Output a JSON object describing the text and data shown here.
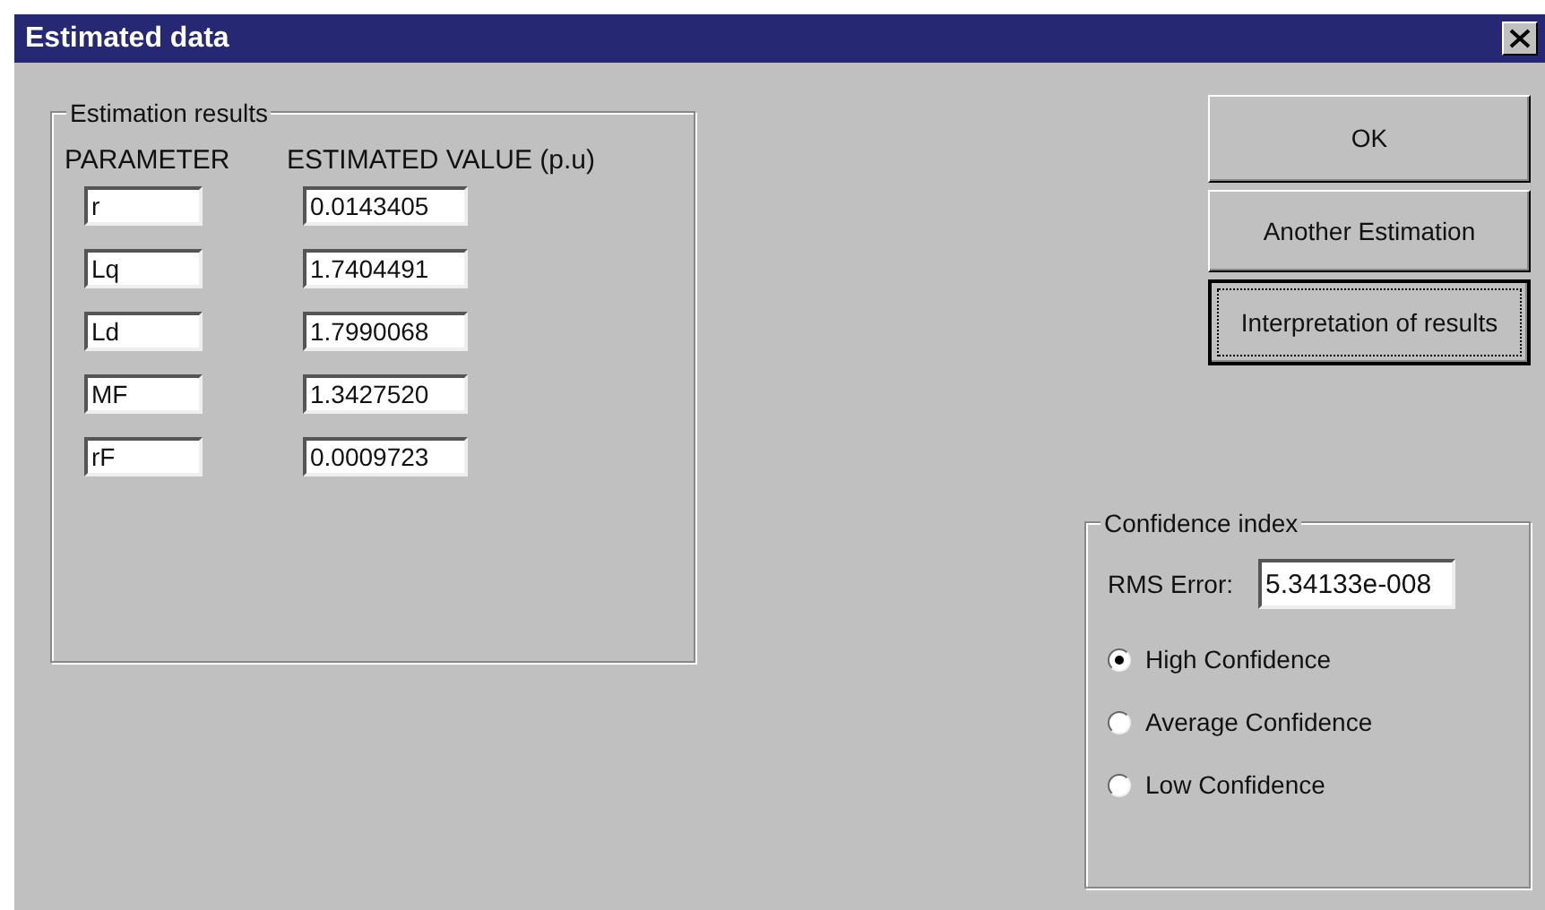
{
  "window": {
    "title": "Estimated data"
  },
  "estimation_results": {
    "title": "Estimation results",
    "column_headers": [
      "PARAMETER",
      "ESTIMATED VALUE (p.u)"
    ],
    "rows": [
      {
        "parameter": "r",
        "value": "0.0143405"
      },
      {
        "parameter": "Lq",
        "value": "1.7404491"
      },
      {
        "parameter": "Ld",
        "value": "1.7990068"
      },
      {
        "parameter": "MF",
        "value": "1.3427520"
      },
      {
        "parameter": "rF",
        "value": "0.0009723"
      }
    ]
  },
  "buttons": [
    {
      "label": "OK",
      "focused": false
    },
    {
      "label": "Another Estimation",
      "focused": false
    },
    {
      "label": "Interpretation of results",
      "focused": true
    }
  ],
  "confidence_index": {
    "title": "Confidence index",
    "rms_label": "RMS Error:",
    "rms_value": "5.34133e-008",
    "options": [
      {
        "label": "High Confidence",
        "selected": true
      },
      {
        "label": "Average Confidence",
        "selected": false
      },
      {
        "label": "Low Confidence",
        "selected": false
      }
    ]
  }
}
